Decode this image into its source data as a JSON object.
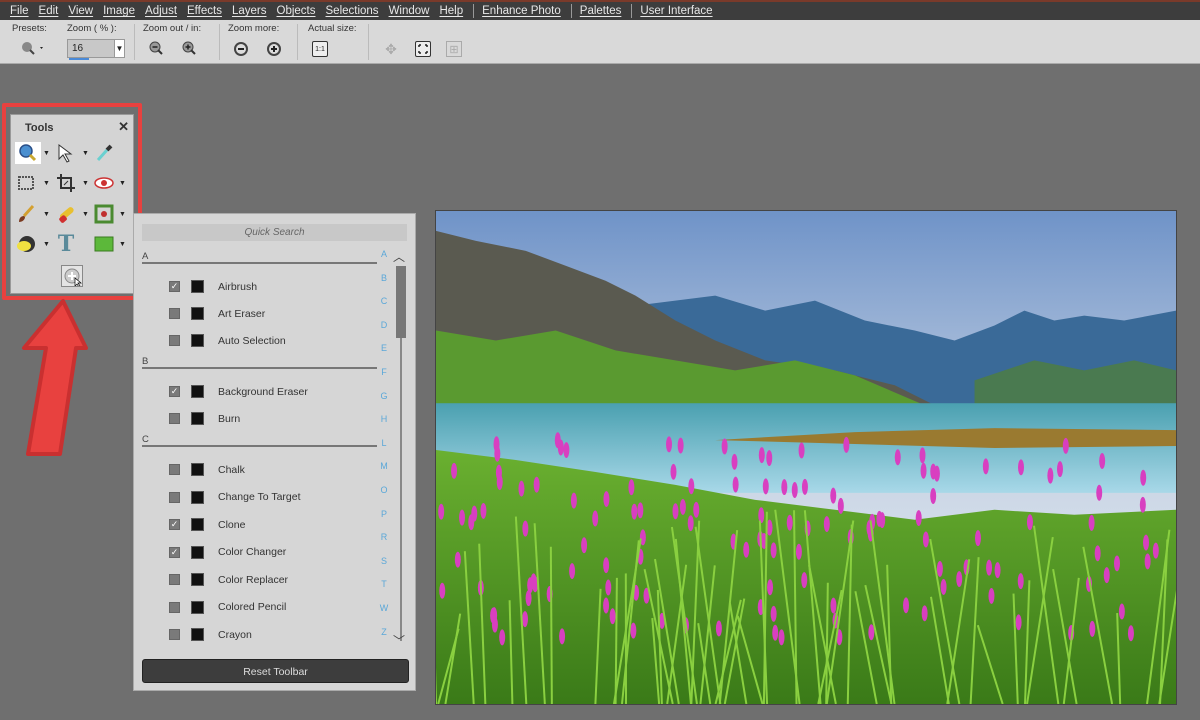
{
  "menu": {
    "items": [
      "File",
      "Edit",
      "View",
      "Image",
      "Adjust",
      "Effects",
      "Layers",
      "Objects",
      "Selections",
      "Window",
      "Help"
    ],
    "extra": [
      "Enhance Photo",
      "Palettes",
      "User Interface"
    ]
  },
  "toolbar": {
    "presets_label": "Presets:",
    "zoom_label": "Zoom ( % ):",
    "zoom_value": "16",
    "zoom_inout_label": "Zoom out / in:",
    "zoom_more_label": "Zoom more:",
    "actual_size_label": "Actual size:",
    "actual_size_icon_text": "1:1"
  },
  "tools_palette": {
    "title": "Tools",
    "close": "✕",
    "text_tool_glyph": "T"
  },
  "quick_search": {
    "placeholder": "Quick Search",
    "sections": [
      {
        "letter": "A",
        "items": [
          {
            "label": "Airbrush",
            "checked": true
          },
          {
            "label": "Art Eraser",
            "checked": false
          },
          {
            "label": "Auto Selection",
            "checked": false
          }
        ]
      },
      {
        "letter": "B",
        "items": [
          {
            "label": "Background Eraser",
            "checked": true
          },
          {
            "label": "Burn",
            "checked": false
          }
        ]
      },
      {
        "letter": "C",
        "items": [
          {
            "label": "Chalk",
            "checked": false
          },
          {
            "label": "Change To Target",
            "checked": false
          },
          {
            "label": "Clone",
            "checked": true
          },
          {
            "label": "Color Changer",
            "checked": true
          },
          {
            "label": "Color Replacer",
            "checked": false
          },
          {
            "label": "Colored Pencil",
            "checked": false
          },
          {
            "label": "Crayon",
            "checked": false
          }
        ]
      }
    ],
    "index": [
      "A",
      "B",
      "C",
      "D",
      "E",
      "F",
      "G",
      "H",
      "L",
      "M",
      "O",
      "P",
      "R",
      "S",
      "T",
      "W",
      "Z"
    ],
    "reset_label": "Reset Toolbar"
  },
  "colors": {
    "highlight": "#e8413f",
    "index_letters": "#5aa7d8",
    "flowers": "#d83fc0"
  }
}
